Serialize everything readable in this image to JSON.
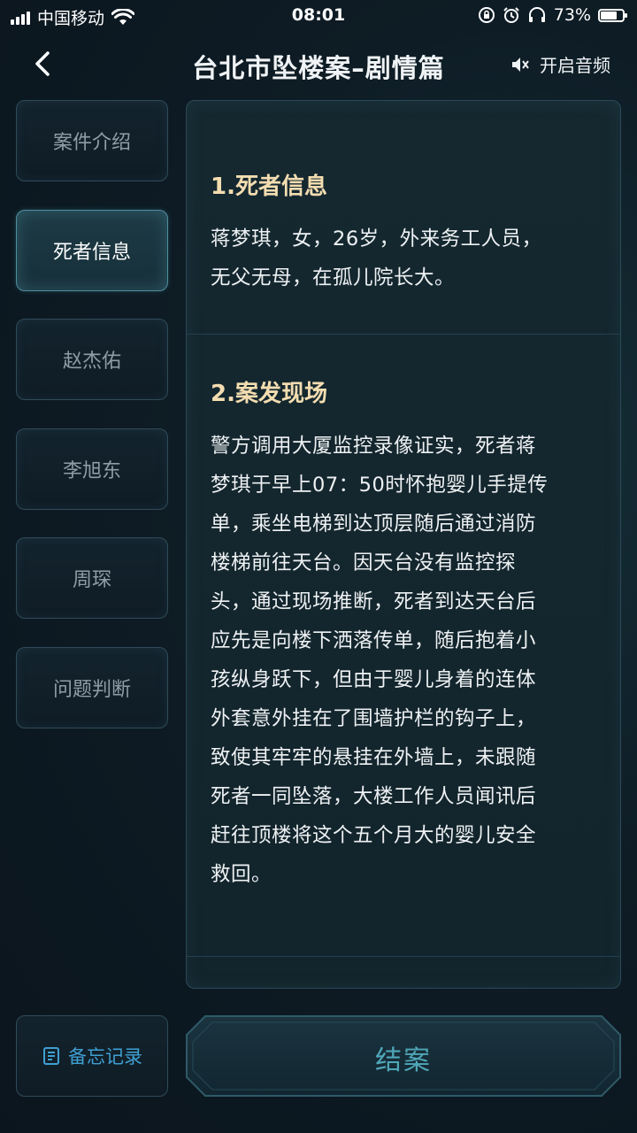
{
  "status_bar": {
    "carrier": "中国移动",
    "time": "08:01",
    "battery": "73%",
    "battery_level": 0.73
  },
  "header": {
    "title": "台北市坠楼案–剧情篇",
    "audio_label": "开启音频"
  },
  "tabs": [
    {
      "label": "案件介绍",
      "active": false
    },
    {
      "label": "死者信息",
      "active": true
    },
    {
      "label": "赵杰佑",
      "active": false
    },
    {
      "label": "李旭东",
      "active": false
    },
    {
      "label": "周琛",
      "active": false
    },
    {
      "label": "问题判断",
      "active": false
    }
  ],
  "content": {
    "sections": [
      {
        "heading": "1.死者信息",
        "lines": [
          "蒋梦琪，女，26岁，外来务工人员，",
          "无父无母，在孤儿院长大。"
        ]
      },
      {
        "heading": "2.案发现场",
        "lines": [
          "警方调用大厦监控录像证实，死者蒋",
          "梦琪于早上07：50时怀抱婴儿手提传",
          "单，乘坐电梯到达顶层随后通过消防",
          "楼梯前往天台。因天台没有监控探",
          "头，通过现场推断，死者到达天台后",
          "应先是向楼下洒落传单，随后抱着小",
          "孩纵身跃下，但由于婴儿身着的连体",
          "外套意外挂在了围墙护栏的钩子上，",
          "致使其牢牢的悬挂在外墙上，未跟随",
          "死者一同坠落，大楼工作人员闻讯后",
          "赶往顶楼将这个五个月大的婴儿安全",
          "救回。"
        ]
      }
    ]
  },
  "bottom": {
    "memo_label": "备忘记录",
    "close_case_label": "结案"
  },
  "colors": {
    "heading": "#f3ddb0",
    "accent": "#4fa7b8",
    "memo": "#3f9fd2"
  }
}
